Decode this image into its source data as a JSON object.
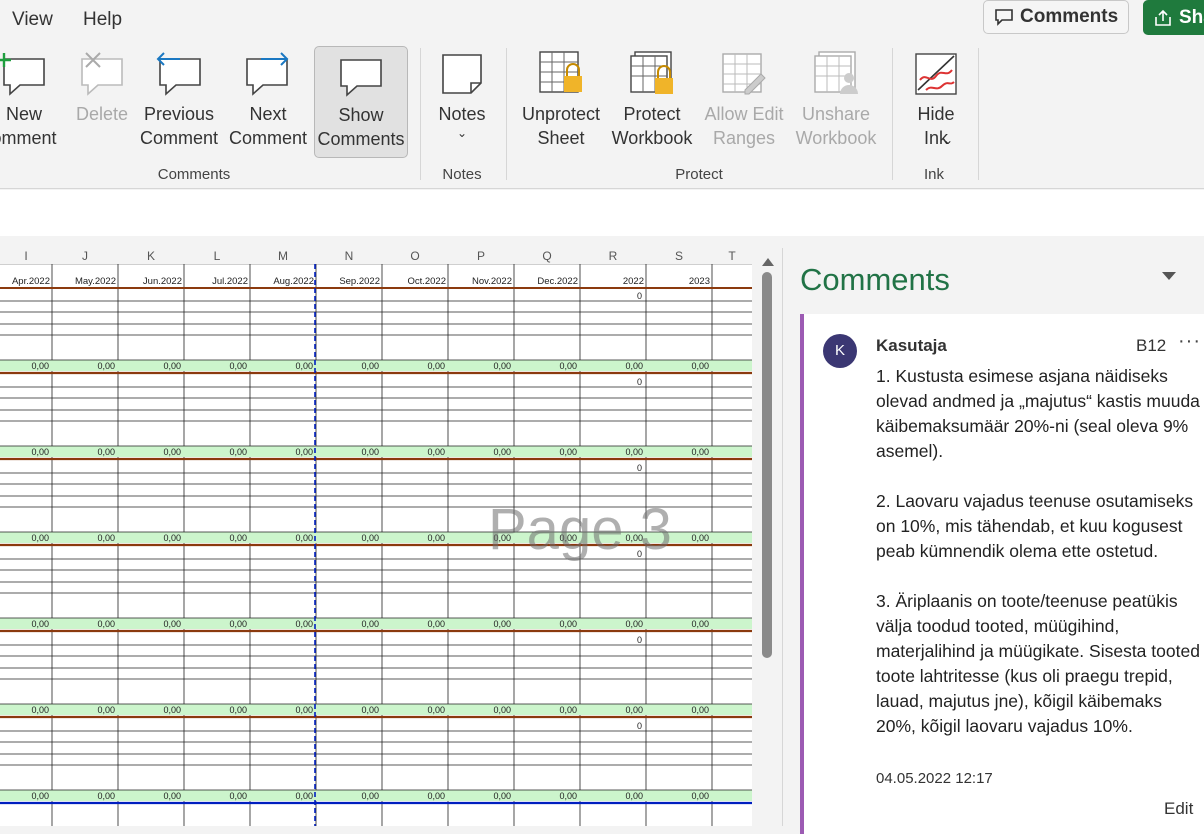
{
  "menubar": {
    "view": "View",
    "help": "Help",
    "comments_button": "Comments",
    "share_button": "Sha"
  },
  "ribbon": {
    "buttons": [
      {
        "label": "New\nomment",
        "enabled": true
      },
      {
        "label": "Delete",
        "enabled": false
      },
      {
        "label": "Previous\nComment",
        "enabled": true
      },
      {
        "label": "Next\nComment",
        "enabled": true
      },
      {
        "label": "Show\nComments",
        "enabled": true,
        "active": true
      },
      {
        "label": "Notes",
        "enabled": true
      },
      {
        "label": "Unprotect\nSheet",
        "enabled": true
      },
      {
        "label": "Protect\nWorkbook",
        "enabled": true
      },
      {
        "label": "Allow Edit\nRanges",
        "enabled": false
      },
      {
        "label": "Unshare\nWorkbook",
        "enabled": false
      },
      {
        "label": "Hide\nInk",
        "enabled": true
      }
    ],
    "groups": [
      "Comments",
      "Notes",
      "Protect",
      "Ink"
    ]
  },
  "sheet": {
    "columns": [
      "I",
      "J",
      "K",
      "L",
      "M",
      "N",
      "O",
      "P",
      "Q",
      "R",
      "S",
      "T"
    ],
    "headers": [
      "Apr.2022",
      "May.2022",
      "Jun.2022",
      "Jul.2022",
      "Aug.2022",
      "Sep.2022",
      "Oct.2022",
      "Nov.2022",
      "Dec.2022",
      "2022",
      "2023",
      ""
    ],
    "zero_value": "0,00",
    "zero_int": "0",
    "watermark": "Page 3"
  },
  "comments_pane": {
    "title": "Comments",
    "comment": {
      "avatar_initial": "K",
      "author": "Kasutaja",
      "cell": "B12",
      "more": "···",
      "paragraphs": [
        "1. Kustusta esimese asjana näidiseks olevad andmed ja „majutus“ kastis muuda käibemaksumäär 20%-ni (seal oleva 9% asemel).",
        "2. Laovaru vajadus teenuse osutamiseks on 10%, mis tähendab, et kuu kogusest peab kümnendik olema ette ostetud.",
        "3. Äriplaanis on toote/teenuse peatükis välja toodud tooted, müügihind, materjalihind ja müügikate. Sisesta tooted toote lahtritesse (kus oli praegu trepid, lauad, majutus jne), kõigil käibemaks 20%, kõigil laovaru vajadus 10%."
      ],
      "date": "04.05.2022 12:17",
      "edit": "Edit"
    }
  },
  "colors": {
    "accent_green": "#217346",
    "comment_bar": "#9c5bb3",
    "row_fill": "#ccf5cc",
    "brown_line": "#8b3a0e",
    "blue_line": "#001fbf"
  }
}
